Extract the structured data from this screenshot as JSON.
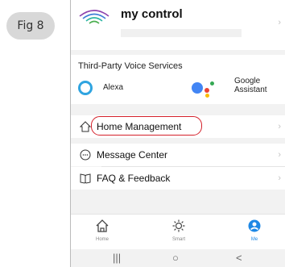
{
  "figure_label": "Fig 8",
  "header": {
    "title": "my control"
  },
  "voice": {
    "title": "Third-Party Voice Services",
    "alexa": "Alexa",
    "google_line1": "Google",
    "google_line2": "Assistant"
  },
  "menu": {
    "home_management": "Home Management",
    "message_center": "Message Center",
    "faq": "FAQ & Feedback"
  },
  "tabs": {
    "home": "Home",
    "smart": "Smart",
    "me": "Me"
  },
  "colors": {
    "accent": "#1e88e5",
    "highlight_oval": "#d4202a",
    "alexa": "#2fa4e0"
  },
  "icons": {
    "chevron": "›",
    "nav_recent": "|||",
    "nav_home": "○",
    "nav_back": "<"
  }
}
